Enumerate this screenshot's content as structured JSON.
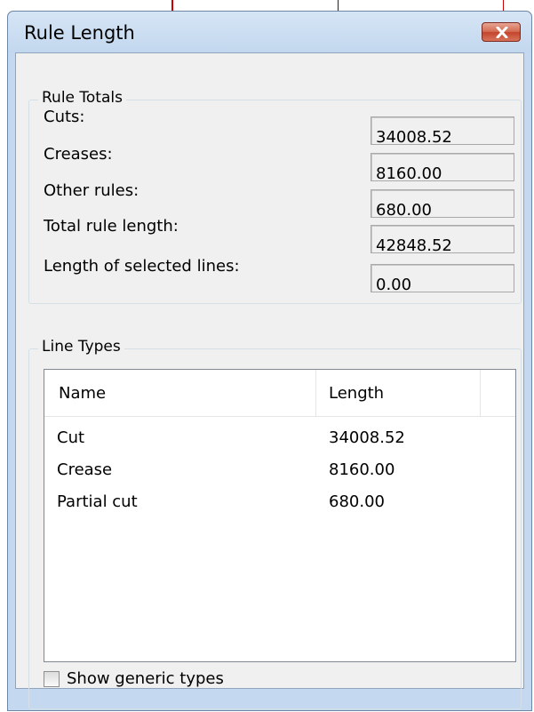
{
  "window": {
    "title": "Rule Length"
  },
  "rule_totals": {
    "title": "Rule Totals",
    "fields": [
      {
        "label": "Cuts:",
        "value": "34008.52"
      },
      {
        "label": "Creases:",
        "value": "8160.00"
      },
      {
        "label": "Other rules:",
        "value": "680.00"
      },
      {
        "label": "Total rule length:",
        "value": "42848.52"
      },
      {
        "label": "Length of selected lines:",
        "value": "0.00"
      }
    ]
  },
  "line_types": {
    "title": "Line Types",
    "columns": [
      "Name",
      "Length"
    ],
    "rows": [
      {
        "name": "Cut",
        "length": "34008.52"
      },
      {
        "name": "Crease",
        "length": "8160.00"
      },
      {
        "name": "Partial cut",
        "length": "680.00"
      }
    ],
    "show_generic": {
      "label": "Show generic types",
      "checked": false
    }
  },
  "icons": {
    "close": "close-icon"
  },
  "colors": {
    "close_button": "#c2452c",
    "title_bar": "#c4d9ef"
  }
}
